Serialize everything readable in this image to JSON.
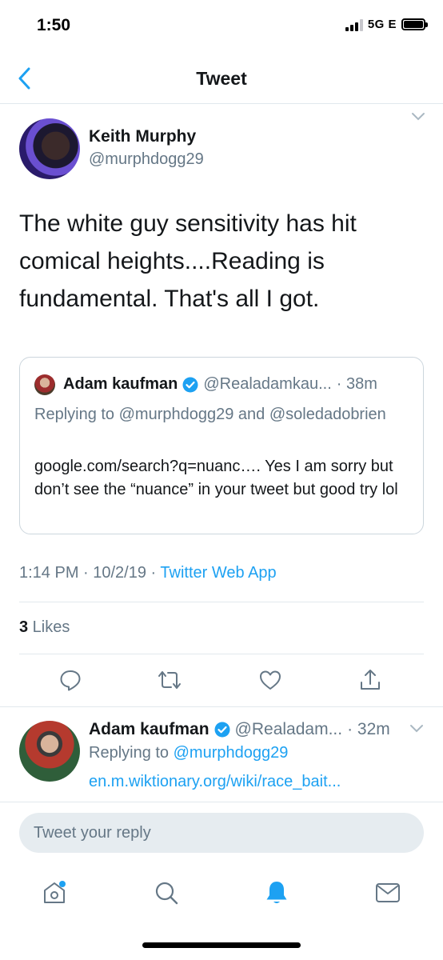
{
  "status": {
    "time": "1:50",
    "network": "5G E"
  },
  "nav": {
    "title": "Tweet"
  },
  "tweet": {
    "author": {
      "name": "Keith Murphy",
      "handle": "@murphdogg29"
    },
    "text": "The white guy sensitivity has hit comical heights....Reading is fundamental. That's all I got.",
    "quote": {
      "name": "Adam kaufman",
      "handle": "@Realadamkau...",
      "time": "· 38m",
      "replying_to": "Replying to @murphdogg29 and @soledadobrien",
      "text": "google.com/search?q=nuanc…. Yes I am sorry but don’t see the “nuance” in your tweet but good try lol"
    },
    "meta": {
      "datetime": "1:14 PM · 10/2/19 · ",
      "source": "Twitter Web App"
    },
    "likes": {
      "count": "3",
      "label": " Likes"
    }
  },
  "actions": [
    "reply-icon",
    "retweet-icon",
    "like-icon",
    "share-icon"
  ],
  "reply": {
    "name": "Adam kaufman",
    "handle": "@Realadam...",
    "time": "· 32m",
    "replying_to_prefix": "Replying to ",
    "replying_to_mention": "@murphdogg29",
    "link": "en.m.wiktionary.org/wiki/race_bait..."
  },
  "composer": {
    "placeholder": "Tweet your reply"
  },
  "tabs": [
    "home-icon",
    "search-icon",
    "notifications-icon",
    "messages-icon"
  ],
  "colors": {
    "accent": "#1da1f2",
    "secondary_text": "#657786",
    "border": "#e1e8ed"
  }
}
